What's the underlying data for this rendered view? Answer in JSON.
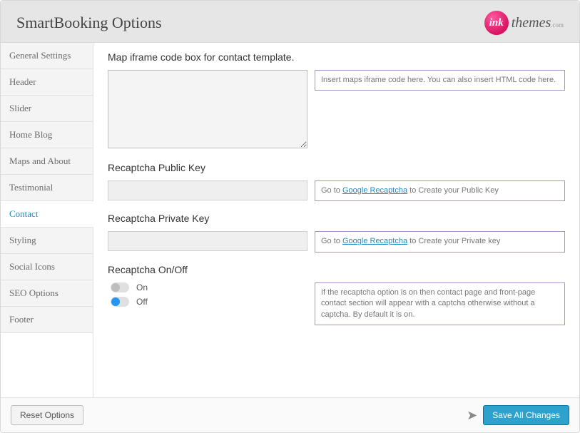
{
  "header": {
    "title": "SmartBooking Options",
    "logo_badge": "ink",
    "logo_text": "themes",
    "logo_suffix": ".com"
  },
  "sidebar": {
    "items": [
      {
        "label": "General Settings",
        "active": false
      },
      {
        "label": "Header",
        "active": false
      },
      {
        "label": "Slider",
        "active": false
      },
      {
        "label": "Home Blog",
        "active": false
      },
      {
        "label": "Maps and About",
        "active": false
      },
      {
        "label": "Testimonial",
        "active": false
      },
      {
        "label": "Contact",
        "active": true
      },
      {
        "label": "Styling",
        "active": false
      },
      {
        "label": "Social Icons",
        "active": false
      },
      {
        "label": "SEO Options",
        "active": false
      },
      {
        "label": "Footer",
        "active": false
      }
    ]
  },
  "fields": {
    "map_iframe": {
      "label": "Map iframe code box for contact template.",
      "value": "",
      "help": "Insert maps iframe code here. You can also insert HTML code here."
    },
    "recaptcha_public": {
      "label": "Recaptcha Public Key",
      "value": "",
      "help_prefix": "Go to ",
      "help_link": "Google Recaptcha",
      "help_suffix": " to Create your Public Key"
    },
    "recaptcha_private": {
      "label": "Recaptcha Private Key",
      "value": "",
      "help_prefix": "Go to ",
      "help_link": "Google Recaptcha",
      "help_suffix": " to Create your Private key"
    },
    "recaptcha_toggle": {
      "label": "Recaptcha On/Off",
      "on_label": "On",
      "off_label": "Off",
      "selected": "off",
      "help": "If the recaptcha option is on then contact page and front-page contact section will appear with a captcha otherwise without a captcha. By default it is on."
    }
  },
  "footer": {
    "reset_label": "Reset Options",
    "save_label": "Save All Changes"
  }
}
